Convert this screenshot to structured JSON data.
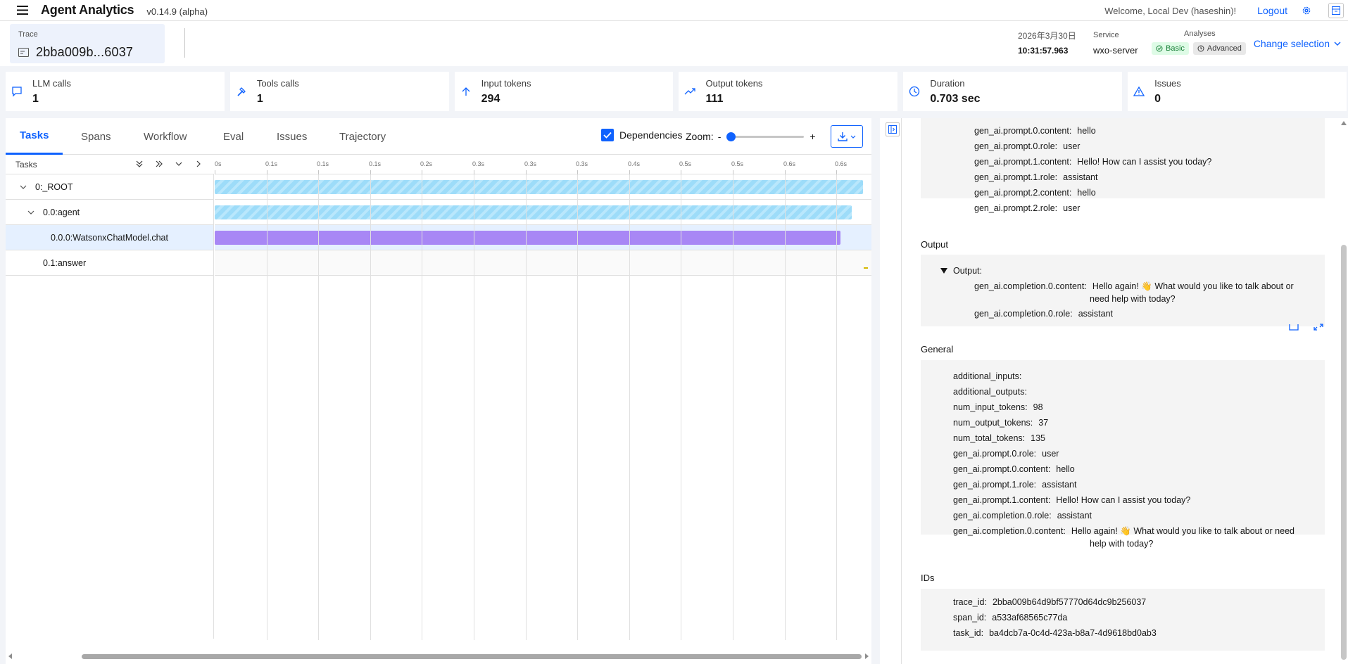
{
  "header": {
    "app_name": "Agent Analytics",
    "version": "v0.14.9 (alpha)",
    "welcome": "Welcome, Local Dev (haseshin)!",
    "logout": "Logout"
  },
  "trace": {
    "label": "Trace",
    "id": "2bba009b...6037",
    "date": "2026年3月30日",
    "time": "10:31:57.963",
    "service_label": "Service",
    "service_value": "wxo-server",
    "analyses_label": "Analyses",
    "basic": "Basic",
    "advanced": "Advanced",
    "change_selection": "Change selection"
  },
  "metrics": [
    {
      "label": "LLM calls",
      "value": "1",
      "icon": "chat-icon"
    },
    {
      "label": "Tools calls",
      "value": "1",
      "icon": "hammer-icon"
    },
    {
      "label": "Input tokens",
      "value": "294",
      "icon": "arrow-up-icon"
    },
    {
      "label": "Output tokens",
      "value": "111",
      "icon": "trend-up-icon"
    },
    {
      "label": "Duration",
      "value": "0.703 sec",
      "icon": "clock-icon"
    },
    {
      "label": "Issues",
      "value": "0",
      "icon": "warning-icon"
    }
  ],
  "tabs": [
    "Tasks",
    "Spans",
    "Workflow",
    "Eval",
    "Issues",
    "Trajectory"
  ],
  "toolbar": {
    "dependencies": "Dependencies",
    "zoom": "Zoom:",
    "zoom_minus": "-",
    "zoom_plus": "+",
    "zoom_level": 0
  },
  "tree": {
    "header": "Tasks",
    "rows": [
      "0:_ROOT",
      "0.0:agent",
      "0.0.0:WatsonxChatModel.chat",
      "0.1:answer"
    ]
  },
  "axis_ticks": [
    "0s",
    "0.1s",
    "0.1s",
    "0.1s",
    "0.2s",
    "0.3s",
    "0.3s",
    "0.3s",
    "0.4s",
    "0.5s",
    "0.5s",
    "0.6s",
    "0.6s"
  ],
  "detail": {
    "prompt_items": [
      {
        "k": "gen_ai.prompt.0.content:",
        "v": "hello"
      },
      {
        "k": "gen_ai.prompt.0.role:",
        "v": "user"
      },
      {
        "k": "gen_ai.prompt.1.content:",
        "v": "Hello! How can I assist you today?"
      },
      {
        "k": "gen_ai.prompt.1.role:",
        "v": "assistant"
      },
      {
        "k": "gen_ai.prompt.2.content:",
        "v": "hello"
      },
      {
        "k": "gen_ai.prompt.2.role:",
        "v": "user"
      }
    ],
    "output_title": "Output",
    "output_toggle": "Output:",
    "output_items": [
      {
        "k": "gen_ai.completion.0.content:",
        "v": "Hello again! 👋 What would you like to talk about or"
      },
      {
        "k": "",
        "v": "need help with today?"
      },
      {
        "k": "gen_ai.completion.0.role:",
        "v": "assistant"
      }
    ],
    "general_title": "General",
    "general_items": [
      {
        "k": "additional_inputs:",
        "v": ""
      },
      {
        "k": "additional_outputs:",
        "v": ""
      },
      {
        "k": "num_input_tokens:",
        "v": "98"
      },
      {
        "k": "num_output_tokens:",
        "v": "37"
      },
      {
        "k": "num_total_tokens:",
        "v": "135"
      },
      {
        "k": "gen_ai.prompt.0.role:",
        "v": "user"
      },
      {
        "k": "gen_ai.prompt.0.content:",
        "v": "hello"
      },
      {
        "k": "gen_ai.prompt.1.role:",
        "v": "assistant"
      },
      {
        "k": "gen_ai.prompt.1.content:",
        "v": "Hello! How can I assist you today?"
      },
      {
        "k": "gen_ai.completion.0.role:",
        "v": "assistant"
      },
      {
        "k": "gen_ai.completion.0.content:",
        "v": "Hello again! 👋 What would you like to talk about or need"
      },
      {
        "k": "",
        "v": "help with today?"
      }
    ],
    "ids_title": "IDs",
    "id_items": [
      {
        "k": "trace_id:",
        "v": "2bba009b64d9bf57770d64dc9b256037"
      },
      {
        "k": "span_id:",
        "v": "a533af68565c77da"
      },
      {
        "k": "task_id:",
        "v": "ba4dcb7a-0c4d-423a-b8a7-4d9618bd0ab3"
      }
    ]
  },
  "colors": {
    "accent": "#0f62fe",
    "bar_hatch": "#9ddcf9",
    "bar_selected": "#a887f5",
    "selected_row": "#e5f0ff"
  }
}
